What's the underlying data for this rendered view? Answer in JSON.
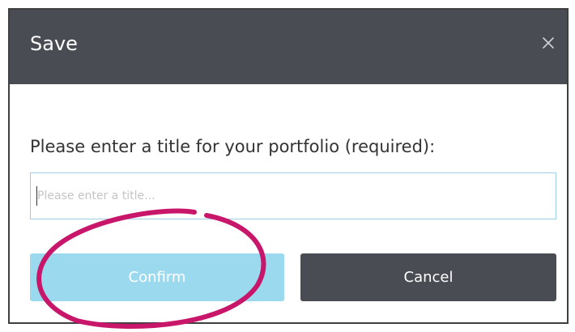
{
  "dialog": {
    "title": "Save",
    "prompt": "Please enter a title for your portfolio (required):",
    "input": {
      "value": "",
      "placeholder": "Please enter a title..."
    },
    "buttons": {
      "confirm_label": "Confirm",
      "cancel_label": "Cancel"
    }
  },
  "icons": {
    "close": "close-icon"
  },
  "colors": {
    "header_bg": "#494c52",
    "confirm_bg": "#9bd9ee",
    "cancel_bg": "#494c52",
    "input_border": "#9ecde6",
    "annotation_stroke": "#c8166b"
  }
}
